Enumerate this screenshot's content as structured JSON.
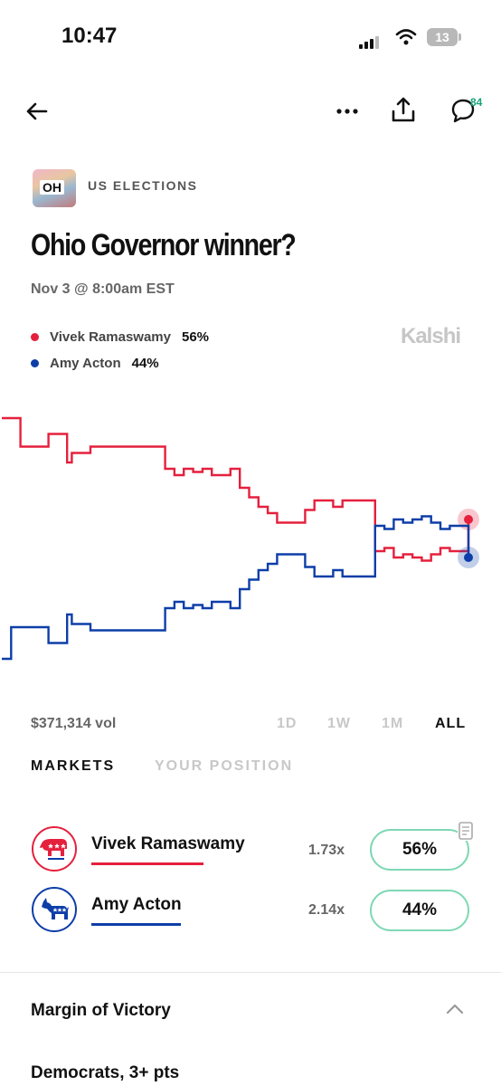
{
  "status_bar": {
    "time": "10:47",
    "battery": "13"
  },
  "header": {
    "back_icon": "arrow-left-icon",
    "more_icon": "more-dots-icon",
    "share_icon": "share-icon",
    "comments_icon": "comment-icon",
    "comments_count": "84"
  },
  "market": {
    "thumbnail_label": "OH",
    "category": "US ELECTIONS",
    "title": "Ohio Governor winner?",
    "date": "Nov 3 @ 8:00am EST",
    "brand": "Kalshi"
  },
  "legend": [
    {
      "name": "Vivek Ramaswamy",
      "pct": "56%",
      "color": "#e5203d"
    },
    {
      "name": "Amy Acton",
      "pct": "44%",
      "color": "#0d3ea8"
    }
  ],
  "chart_data": {
    "type": "line",
    "ylim": [
      0,
      100
    ],
    "x": [
      0,
      2,
      4,
      6,
      8,
      10,
      12,
      14,
      15,
      17,
      19,
      21,
      23,
      25,
      27,
      29,
      31,
      33,
      35,
      37,
      39,
      41,
      43,
      45,
      47,
      49,
      51,
      53,
      55,
      57,
      59,
      61,
      63,
      65,
      67,
      69,
      71,
      73,
      75,
      77,
      79,
      80,
      82,
      84,
      86,
      88,
      90,
      92,
      94,
      96,
      98,
      100
    ],
    "series": [
      {
        "name": "Vivek Ramaswamy",
        "color": "#e5203d",
        "values": [
          88,
          88,
          79,
          79,
          79,
          83,
          83,
          74,
          77,
          77,
          79,
          79,
          79,
          79,
          79,
          79,
          79,
          79,
          72,
          70,
          72,
          71,
          72,
          70,
          70,
          72,
          66,
          63,
          60,
          58,
          55,
          55,
          55,
          59,
          62,
          62,
          60,
          62,
          62,
          62,
          62,
          46,
          47,
          44,
          45,
          44,
          43,
          45,
          47,
          46,
          46,
          56
        ]
      },
      {
        "name": "Amy Acton",
        "color": "#0d3ea8",
        "values": [
          12,
          22,
          22,
          22,
          22,
          17,
          17,
          26,
          23,
          23,
          21,
          21,
          21,
          21,
          21,
          21,
          21,
          21,
          28,
          30,
          28,
          29,
          28,
          30,
          30,
          28,
          34,
          37,
          40,
          42,
          45,
          45,
          45,
          41,
          38,
          38,
          40,
          38,
          38,
          38,
          38,
          54,
          53,
          56,
          55,
          56,
          57,
          55,
          53,
          54,
          54,
          44
        ]
      }
    ]
  },
  "volume": "$371,314 vol",
  "ranges": [
    "1D",
    "1W",
    "1M",
    "ALL"
  ],
  "active_range": "ALL",
  "tabs": [
    "MARKETS",
    "YOUR POSITION"
  ],
  "candidates": [
    {
      "name": "Vivek Ramaswamy",
      "multiplier": "1.73x",
      "pct": "56%",
      "color": "#e5203d",
      "logo": "republican-elephant-icon"
    },
    {
      "name": "Amy Acton",
      "multiplier": "2.14x",
      "pct": "44%",
      "color": "#0d3ea8",
      "logo": "democrat-donkey-icon"
    }
  ],
  "section": {
    "title": "Margin of Victory",
    "first_item": "Democrats, 3+ pts"
  }
}
